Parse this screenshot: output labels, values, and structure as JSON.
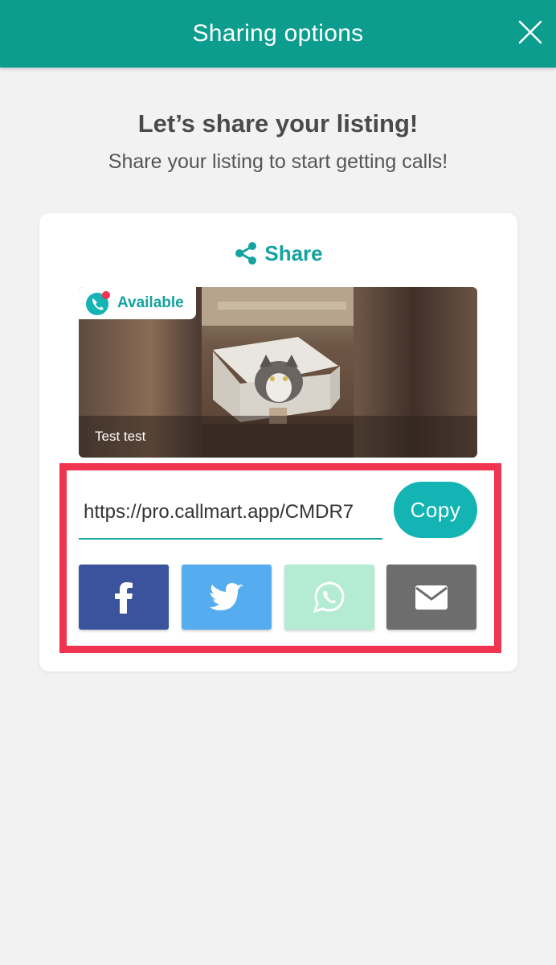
{
  "header": {
    "title": "Sharing options",
    "background": "#0d9d8f"
  },
  "intro": {
    "headline": "Let’s share your listing!",
    "subline": "Share your listing to start getting calls!"
  },
  "share_card": {
    "share_label": "Share",
    "listing": {
      "status_badge": "Available",
      "name": "Test test"
    },
    "link": {
      "url": "https://pro.callmart.app/CMDR7",
      "copy_label": "Copy"
    },
    "social_buttons": [
      {
        "name": "facebook",
        "icon": "facebook-icon",
        "color": "#3b539c"
      },
      {
        "name": "twitter",
        "icon": "twitter-icon",
        "color": "#55adf0"
      },
      {
        "name": "whatsapp",
        "icon": "whatsapp-icon",
        "color": "#b3ecd3"
      },
      {
        "name": "email",
        "icon": "envelope-icon",
        "color": "#6d6d6d"
      }
    ]
  },
  "colors": {
    "accent": "#14a3a0",
    "highlight_border": "#f0334f",
    "page_background": "#f2f2f2"
  }
}
